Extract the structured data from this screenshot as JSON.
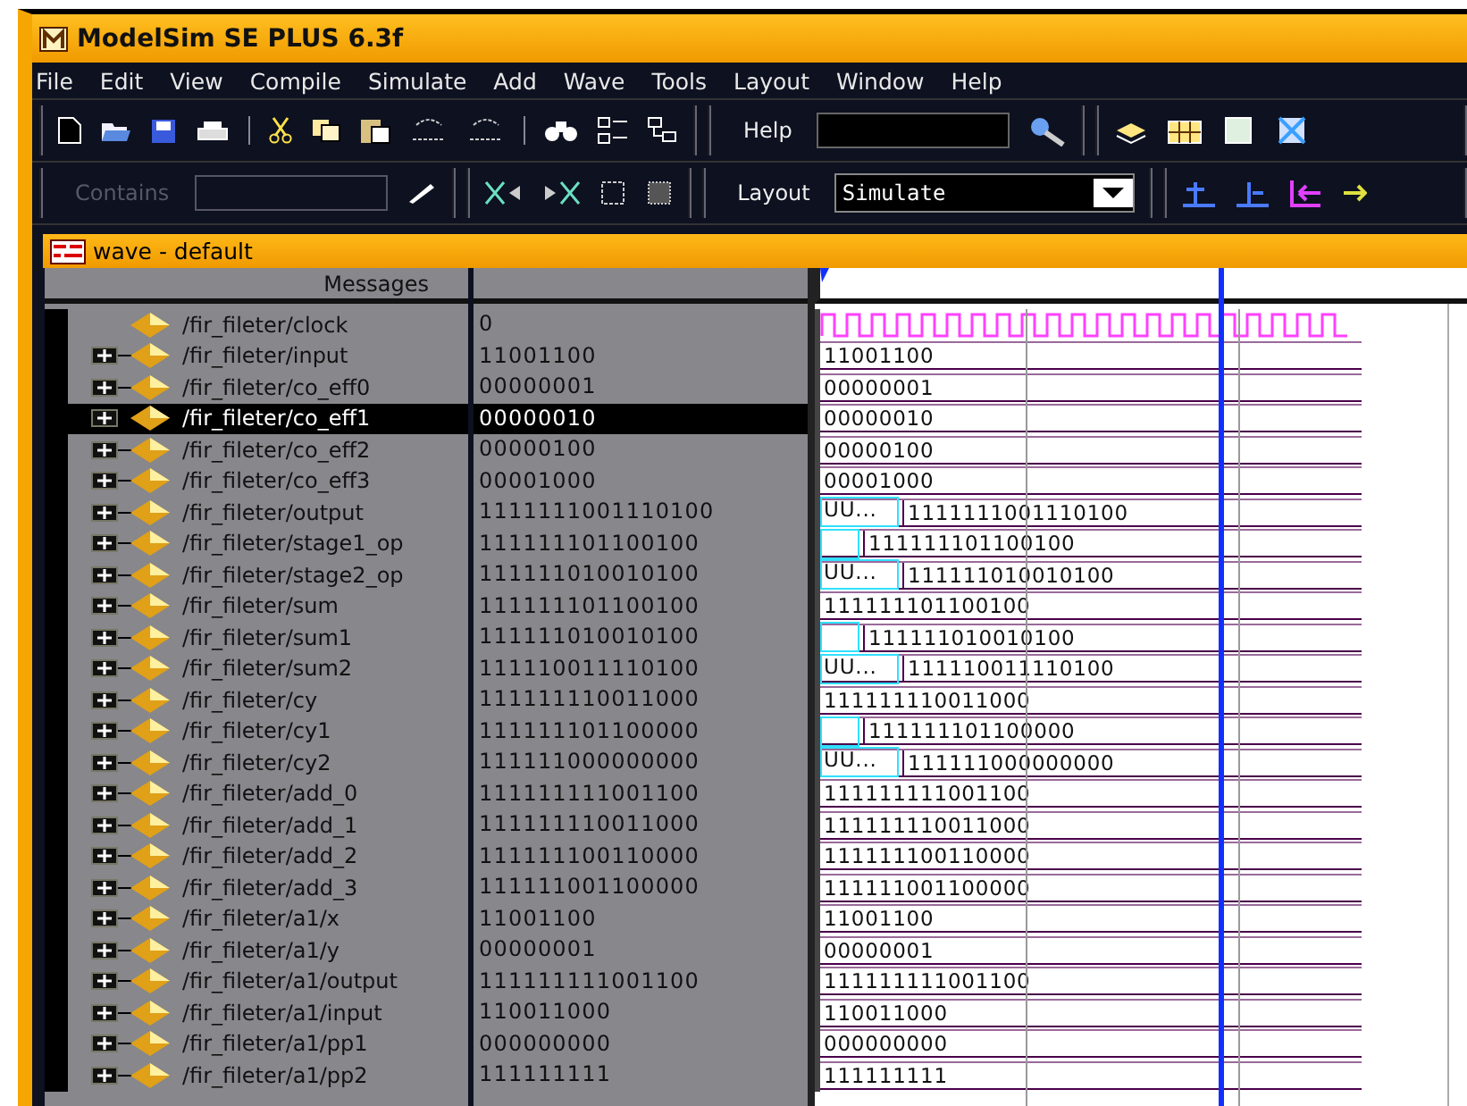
{
  "window": {
    "title": "ModelSim SE PLUS 6.3f"
  },
  "menu": [
    "File",
    "Edit",
    "View",
    "Compile",
    "Simulate",
    "Add",
    "Wave",
    "Tools",
    "Layout",
    "Window",
    "Help"
  ],
  "toolbar": {
    "help_label": "Help",
    "contains_label": "Contains",
    "contains_disabled": true,
    "layout_label": "Layout",
    "layout_value": "Simulate"
  },
  "wave_window": {
    "title": "wave - default",
    "header": "Messages",
    "signals": [
      {
        "kind": "scalar",
        "name": "/fir_fileter/clock",
        "value": "0",
        "selected": false,
        "wave": {
          "kind": "clock"
        }
      },
      {
        "kind": "bus",
        "name": "/fir_fileter/input",
        "value": "11001100",
        "selected": false,
        "wave": {
          "kind": "bus",
          "segments": [
            {
              "kind": "value",
              "text": "11001100"
            }
          ]
        }
      },
      {
        "kind": "bus",
        "name": "/fir_fileter/co_eff0",
        "value": "00000001",
        "selected": false,
        "wave": {
          "kind": "bus",
          "segments": [
            {
              "kind": "value",
              "text": "00000001"
            }
          ]
        }
      },
      {
        "kind": "bus",
        "name": "/fir_fileter/co_eff1",
        "value": "00000010",
        "selected": true,
        "wave": {
          "kind": "bus",
          "segments": [
            {
              "kind": "value",
              "text": "00000010"
            }
          ]
        }
      },
      {
        "kind": "bus",
        "name": "/fir_fileter/co_eff2",
        "value": "00000100",
        "selected": false,
        "wave": {
          "kind": "bus",
          "segments": [
            {
              "kind": "value",
              "text": "00000100"
            }
          ]
        }
      },
      {
        "kind": "bus",
        "name": "/fir_fileter/co_eff3",
        "value": "00001000",
        "selected": false,
        "wave": {
          "kind": "bus",
          "segments": [
            {
              "kind": "value",
              "text": "00001000"
            }
          ]
        }
      },
      {
        "kind": "bus",
        "name": "/fir_fileter/output",
        "value": "1111111001110100",
        "selected": false,
        "wave": {
          "kind": "bus",
          "segments": [
            {
              "kind": "undefined",
              "text": "UU..."
            },
            {
              "kind": "value",
              "text": "1111111001110100"
            }
          ]
        }
      },
      {
        "kind": "bus",
        "name": "/fir_fileter/stage1_op",
        "value": "111111101100100",
        "selected": false,
        "wave": {
          "kind": "bus",
          "segments": [
            {
              "kind": "undefined"
            },
            {
              "kind": "value",
              "text": "111111101100100"
            }
          ]
        }
      },
      {
        "kind": "bus",
        "name": "/fir_fileter/stage2_op",
        "value": "111111010010100",
        "selected": false,
        "wave": {
          "kind": "bus",
          "segments": [
            {
              "kind": "undefined",
              "text": "UU..."
            },
            {
              "kind": "value",
              "text": "111111010010100"
            }
          ]
        }
      },
      {
        "kind": "bus",
        "name": "/fir_fileter/sum",
        "value": "111111101100100",
        "selected": false,
        "wave": {
          "kind": "bus",
          "segments": [
            {
              "kind": "value",
              "text": "111111101100100"
            }
          ]
        }
      },
      {
        "kind": "bus",
        "name": "/fir_fileter/sum1",
        "value": "111111010010100",
        "selected": false,
        "wave": {
          "kind": "bus",
          "segments": [
            {
              "kind": "undefined"
            },
            {
              "kind": "value",
              "text": "111111010010100"
            }
          ]
        }
      },
      {
        "kind": "bus",
        "name": "/fir_fileter/sum2",
        "value": "111110011110100",
        "selected": false,
        "wave": {
          "kind": "bus",
          "segments": [
            {
              "kind": "undefined",
              "text": "UU..."
            },
            {
              "kind": "value",
              "text": "111110011110100"
            }
          ]
        }
      },
      {
        "kind": "bus",
        "name": "/fir_fileter/cy",
        "value": "111111110011000",
        "selected": false,
        "wave": {
          "kind": "bus",
          "segments": [
            {
              "kind": "value",
              "text": "111111110011000"
            }
          ]
        }
      },
      {
        "kind": "bus",
        "name": "/fir_fileter/cy1",
        "value": "111111101100000",
        "selected": false,
        "wave": {
          "kind": "bus",
          "segments": [
            {
              "kind": "undefined"
            },
            {
              "kind": "value",
              "text": "111111101100000"
            }
          ]
        }
      },
      {
        "kind": "bus",
        "name": "/fir_fileter/cy2",
        "value": "111111000000000",
        "selected": false,
        "wave": {
          "kind": "bus",
          "segments": [
            {
              "kind": "undefined",
              "text": "UU..."
            },
            {
              "kind": "value",
              "text": "111111000000000"
            }
          ]
        }
      },
      {
        "kind": "bus",
        "name": "/fir_fileter/add_0",
        "value": "111111111001100",
        "selected": false,
        "wave": {
          "kind": "bus",
          "segments": [
            {
              "kind": "value",
              "text": "111111111001100"
            }
          ]
        }
      },
      {
        "kind": "bus",
        "name": "/fir_fileter/add_1",
        "value": "111111110011000",
        "selected": false,
        "wave": {
          "kind": "bus",
          "segments": [
            {
              "kind": "value",
              "text": "111111110011000"
            }
          ]
        }
      },
      {
        "kind": "bus",
        "name": "/fir_fileter/add_2",
        "value": "111111100110000",
        "selected": false,
        "wave": {
          "kind": "bus",
          "segments": [
            {
              "kind": "value",
              "text": "111111100110000"
            }
          ]
        }
      },
      {
        "kind": "bus",
        "name": "/fir_fileter/add_3",
        "value": "111111001100000",
        "selected": false,
        "wave": {
          "kind": "bus",
          "segments": [
            {
              "kind": "value",
              "text": "111111001100000"
            }
          ]
        }
      },
      {
        "kind": "bus",
        "name": "/fir_fileter/a1/x",
        "value": "11001100",
        "selected": false,
        "wave": {
          "kind": "bus",
          "segments": [
            {
              "kind": "value",
              "text": "11001100"
            }
          ]
        }
      },
      {
        "kind": "bus",
        "name": "/fir_fileter/a1/y",
        "value": "00000001",
        "selected": false,
        "wave": {
          "kind": "bus",
          "segments": [
            {
              "kind": "value",
              "text": "00000001"
            }
          ]
        }
      },
      {
        "kind": "bus",
        "name": "/fir_fileter/a1/output",
        "value": "111111111001100",
        "selected": false,
        "wave": {
          "kind": "bus",
          "segments": [
            {
              "kind": "value",
              "text": "111111111001100"
            }
          ]
        }
      },
      {
        "kind": "bus",
        "name": "/fir_fileter/a1/input",
        "value": "110011000",
        "selected": false,
        "wave": {
          "kind": "bus",
          "segments": [
            {
              "kind": "value",
              "text": "110011000"
            }
          ]
        }
      },
      {
        "kind": "bus",
        "name": "/fir_fileter/a1/pp1",
        "value": "000000000",
        "selected": false,
        "wave": {
          "kind": "bus",
          "segments": [
            {
              "kind": "value",
              "text": "000000000"
            }
          ]
        }
      },
      {
        "kind": "bus",
        "name": "/fir_fileter/a1/pp2",
        "value": "111111111",
        "selected": false,
        "wave": {
          "kind": "bus",
          "segments": [
            {
              "kind": "value",
              "text": "111111111"
            }
          ]
        }
      }
    ]
  }
}
